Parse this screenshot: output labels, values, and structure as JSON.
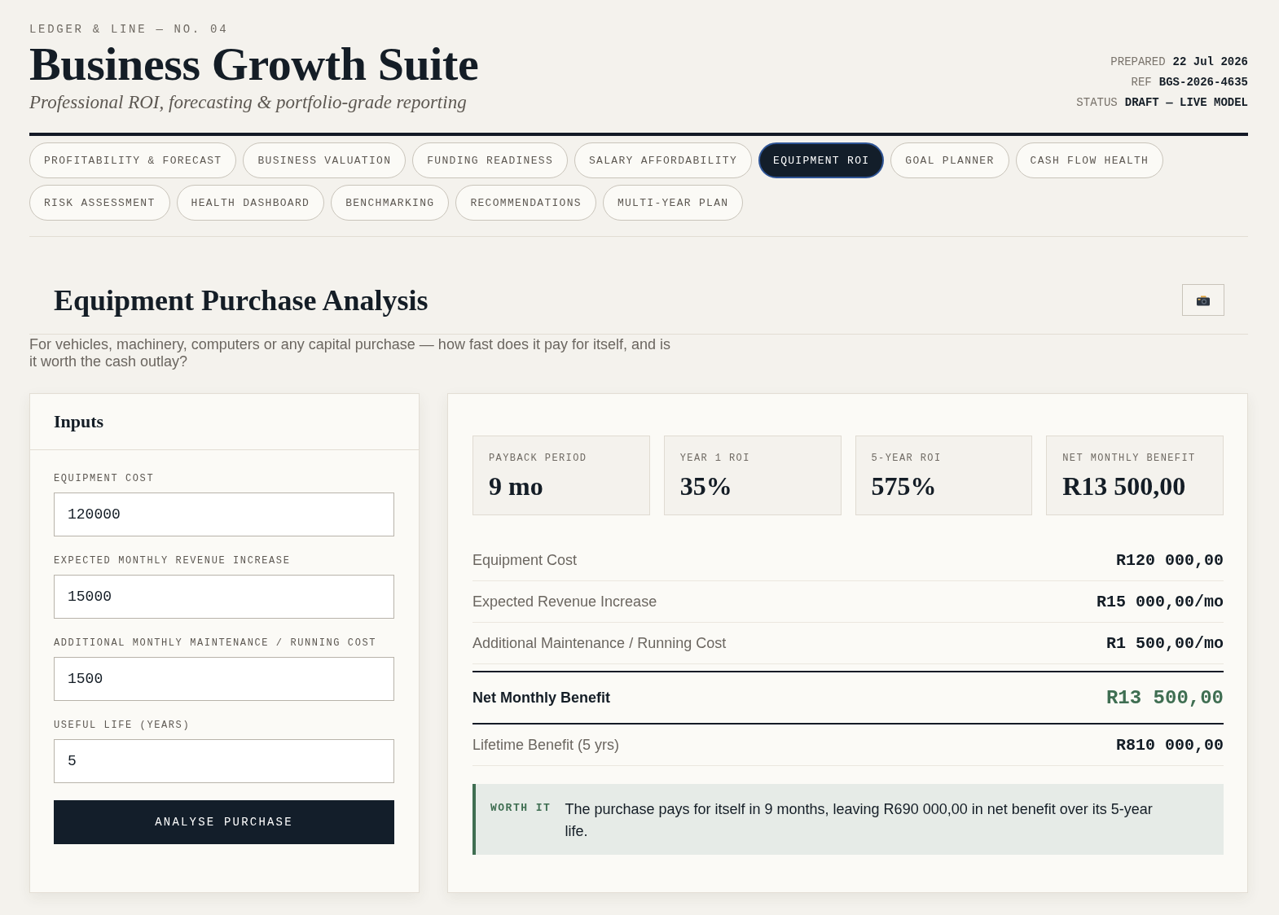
{
  "header": {
    "eyebrow": "LEDGER & LINE — NO. 04",
    "title": "Business Growth Suite",
    "subtitle": "Professional ROI, forecasting & portfolio-grade reporting",
    "meta": [
      {
        "label": "PREPARED",
        "value": "22 Jul 2026"
      },
      {
        "label": "REF",
        "value": "BGS-2026-4635"
      },
      {
        "label": "STATUS",
        "value": "DRAFT — LIVE MODEL"
      }
    ]
  },
  "tabs": [
    {
      "label": "PROFITABILITY & FORECAST",
      "selected": false
    },
    {
      "label": "BUSINESS VALUATION",
      "selected": false
    },
    {
      "label": "FUNDING READINESS",
      "selected": false
    },
    {
      "label": "SALARY AFFORDABILITY",
      "selected": false
    },
    {
      "label": "EQUIPMENT ROI",
      "selected": true
    },
    {
      "label": "GOAL PLANNER",
      "selected": false
    },
    {
      "label": "CASH FLOW HEALTH",
      "selected": false
    },
    {
      "label": "RISK ASSESSMENT",
      "selected": false
    },
    {
      "label": "HEALTH DASHBOARD",
      "selected": false
    },
    {
      "label": "BENCHMARKING",
      "selected": false
    },
    {
      "label": "RECOMMENDATIONS",
      "selected": false
    },
    {
      "label": "MULTI-YEAR PLAN",
      "selected": false
    }
  ],
  "section": {
    "title": "Equipment Purchase Analysis",
    "description": "For vehicles, machinery, computers or any capital purchase — how fast does it pay for itself, and is it worth the cash outlay?"
  },
  "inputs_panel": {
    "title": "Inputs",
    "fields": [
      {
        "label": "EQUIPMENT COST",
        "value": "120000"
      },
      {
        "label": "EXPECTED MONTHLY REVENUE INCREASE",
        "value": "15000"
      },
      {
        "label": "ADDITIONAL MONTHLY MAINTENANCE / RUNNING COST",
        "value": "1500"
      },
      {
        "label": "USEFUL LIFE (YEARS)",
        "value": "5"
      }
    ],
    "button": "ANALYSE PURCHASE"
  },
  "results": {
    "kpis": [
      {
        "label": "PAYBACK PERIOD",
        "value": "9 mo"
      },
      {
        "label": "YEAR 1 ROI",
        "value": "35%"
      },
      {
        "label": "5-YEAR ROI",
        "value": "575%"
      },
      {
        "label": "NET MONTHLY BENEFIT",
        "value": "R13 500,00"
      }
    ],
    "rows": [
      {
        "kind": "plain",
        "label": "Equipment Cost",
        "value": "R120 000,00"
      },
      {
        "kind": "plain",
        "label": "Expected Revenue Increase",
        "value": "R15 000,00/mo"
      },
      {
        "kind": "plain",
        "label": "Additional Maintenance / Running Cost",
        "value": "R1 500,00/mo"
      },
      {
        "kind": "total",
        "label": "Net Monthly Benefit",
        "value": "R13 500,00"
      },
      {
        "kind": "plain",
        "label": "Lifetime Benefit (5 yrs)",
        "value": "R810 000,00"
      }
    ],
    "verdict": {
      "tag": "WORTH IT",
      "text": "The purchase pays for itself in 9 months, leaving R690 000,00 in net benefit over its 5-year life."
    }
  }
}
